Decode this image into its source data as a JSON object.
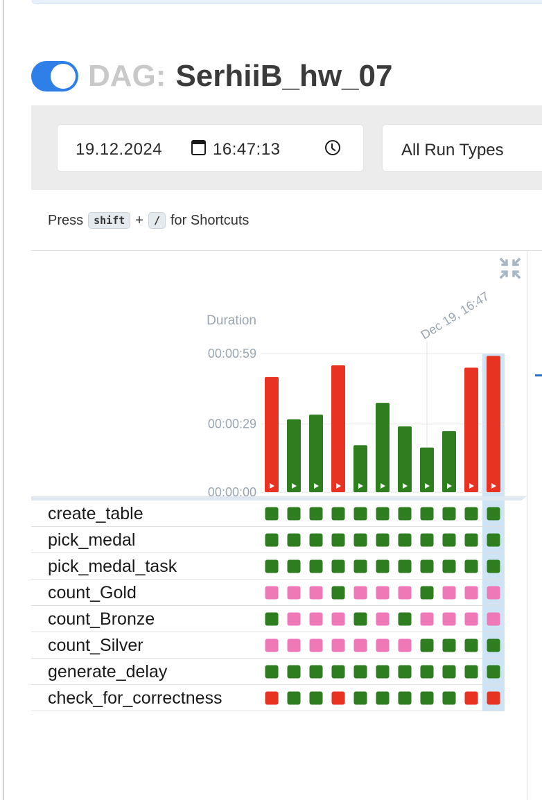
{
  "dag": {
    "label": "DAG:",
    "name": "SerhiiB_hw_07",
    "paused_toggle": "on"
  },
  "filters": {
    "date": "19.12.2024",
    "time": "16:47:13",
    "run_type": "All Run Types"
  },
  "shortcuts": {
    "prefix": "Press",
    "key1": "shift",
    "plus": "+",
    "key2": "/",
    "suffix": "for Shortcuts"
  },
  "chart_data": {
    "type": "bar",
    "ylabel": "Duration",
    "y_ticks": [
      "00:00:00",
      "00:00:29",
      "00:00:59"
    ],
    "ylim": [
      0,
      59
    ],
    "top_label": "Dec 19, 16:47",
    "values": [
      49,
      31,
      33,
      54,
      20,
      38,
      28,
      19,
      26,
      53,
      58
    ],
    "bar_states": [
      "failed",
      "success",
      "success",
      "failed",
      "success",
      "success",
      "success",
      "success",
      "success",
      "failed",
      "failed"
    ]
  },
  "colors": {
    "success": "#2e7d1f",
    "failed": "#e83323",
    "upstream_failed": "#ee78b8",
    "selected_column": "#c6dff3",
    "toggle": "#2f7fe8"
  },
  "tasks": [
    {
      "name": "create_table",
      "states": [
        "success",
        "success",
        "success",
        "success",
        "success",
        "success",
        "success",
        "success",
        "success",
        "success",
        "success"
      ]
    },
    {
      "name": "pick_medal",
      "states": [
        "success",
        "success",
        "success",
        "success",
        "success",
        "success",
        "success",
        "success",
        "success",
        "success",
        "success"
      ]
    },
    {
      "name": "pick_medal_task",
      "states": [
        "success",
        "success",
        "success",
        "success",
        "success",
        "success",
        "success",
        "success",
        "success",
        "success",
        "success"
      ]
    },
    {
      "name": "count_Gold",
      "states": [
        "upstream_failed",
        "upstream_failed",
        "upstream_failed",
        "success",
        "upstream_failed",
        "upstream_failed",
        "upstream_failed",
        "success",
        "upstream_failed",
        "upstream_failed",
        "upstream_failed"
      ]
    },
    {
      "name": "count_Bronze",
      "states": [
        "success",
        "upstream_failed",
        "upstream_failed",
        "upstream_failed",
        "success",
        "upstream_failed",
        "success",
        "upstream_failed",
        "upstream_failed",
        "upstream_failed",
        "upstream_failed"
      ]
    },
    {
      "name": "count_Silver",
      "states": [
        "upstream_failed",
        "upstream_failed",
        "upstream_failed",
        "upstream_failed",
        "upstream_failed",
        "upstream_failed",
        "upstream_failed",
        "success",
        "success",
        "success",
        "success"
      ]
    },
    {
      "name": "generate_delay",
      "states": [
        "success",
        "success",
        "success",
        "success",
        "success",
        "success",
        "success",
        "success",
        "success",
        "success",
        "success"
      ]
    },
    {
      "name": "check_for_correctness",
      "states": [
        "failed",
        "success",
        "success",
        "failed",
        "success",
        "success",
        "success",
        "success",
        "success",
        "failed",
        "failed"
      ]
    }
  ],
  "icons": {
    "calendar": "calendar-icon",
    "clock": "clock-icon",
    "collapse": "collapse-arrows-icon",
    "run_play": "play-icon"
  }
}
